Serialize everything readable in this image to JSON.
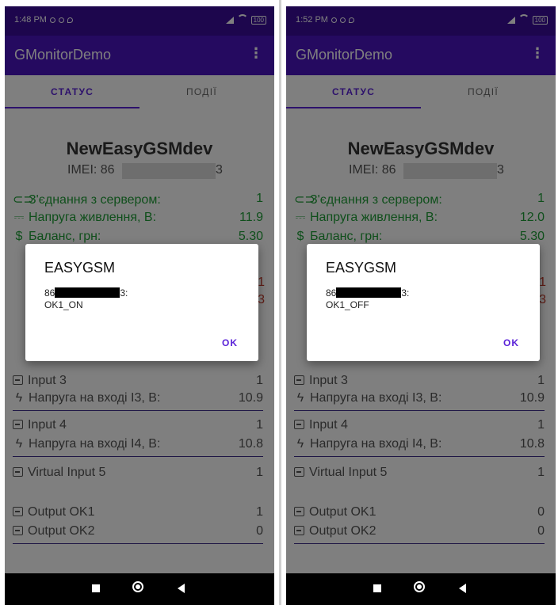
{
  "screens": [
    {
      "status_bar": {
        "time": "1:48 PM",
        "battery": "100"
      },
      "app_bar": {
        "title": "GMonitorDemo",
        "menu_icon": "more-vert-icon"
      },
      "tabs": [
        {
          "label": "СТАТУС",
          "active": true
        },
        {
          "label": "ПОДІЇ",
          "active": false
        }
      ],
      "device": {
        "name": "NewEasyGSMdev",
        "imei_label": "IMEI: 86",
        "imei_tail": "3"
      },
      "rows": {
        "connection": {
          "label": "З'єднання з сервером:",
          "value": "1"
        },
        "supply": {
          "label": "Напруга живлення, В:",
          "value": "11.9"
        },
        "balance": {
          "label": "Баланс, грн:",
          "value": "5.30"
        },
        "input3": {
          "label": "Input 3",
          "value": "1"
        },
        "input3_v": {
          "label": "Напруга на вході I3, В:",
          "value": "10.9"
        },
        "input4": {
          "label": "Input 4",
          "value": "1"
        },
        "input4_v": {
          "label": "Напруга на вході I4, В:",
          "value": "10.8"
        },
        "vinput5": {
          "label": "Virtual Input 5",
          "value": "1"
        },
        "out1": {
          "label": "Output OK1",
          "value": "1"
        },
        "out2": {
          "label": "Output OK2",
          "value": "0"
        }
      },
      "dialog": {
        "title": "EASYGSM",
        "msg_prefix": "86",
        "msg_suffix": "3:",
        "msg_line2": "OK1_ON",
        "ok_label": "OK"
      }
    },
    {
      "status_bar": {
        "time": "1:52 PM",
        "battery": "100"
      },
      "app_bar": {
        "title": "GMonitorDemo",
        "menu_icon": "more-vert-icon"
      },
      "tabs": [
        {
          "label": "СТАТУС",
          "active": true
        },
        {
          "label": "ПОДІЇ",
          "active": false
        }
      ],
      "device": {
        "name": "NewEasyGSMdev",
        "imei_label": "IMEI: 86",
        "imei_tail": "3"
      },
      "rows": {
        "connection": {
          "label": "З'єднання з сервером:",
          "value": "1"
        },
        "supply": {
          "label": "Напруга живлення, В:",
          "value": "12.0"
        },
        "balance": {
          "label": "Баланс, грн:",
          "value": "5.30"
        },
        "input3": {
          "label": "Input 3",
          "value": "1"
        },
        "input3_v": {
          "label": "Напруга на вході I3, В:",
          "value": "10.9"
        },
        "input4": {
          "label": "Input 4",
          "value": "1"
        },
        "input4_v": {
          "label": "Напруга на вході I4, В:",
          "value": "10.8"
        },
        "vinput5": {
          "label": "Virtual Input 5",
          "value": "1"
        },
        "out1": {
          "label": "Output OK1",
          "value": "0"
        },
        "out2": {
          "label": "Output OK2",
          "value": "0"
        }
      },
      "dialog": {
        "title": "EASYGSM",
        "msg_prefix": "86",
        "msg_suffix": "3:",
        "msg_line2": "OK1_OFF",
        "ok_label": "OK"
      }
    }
  ]
}
